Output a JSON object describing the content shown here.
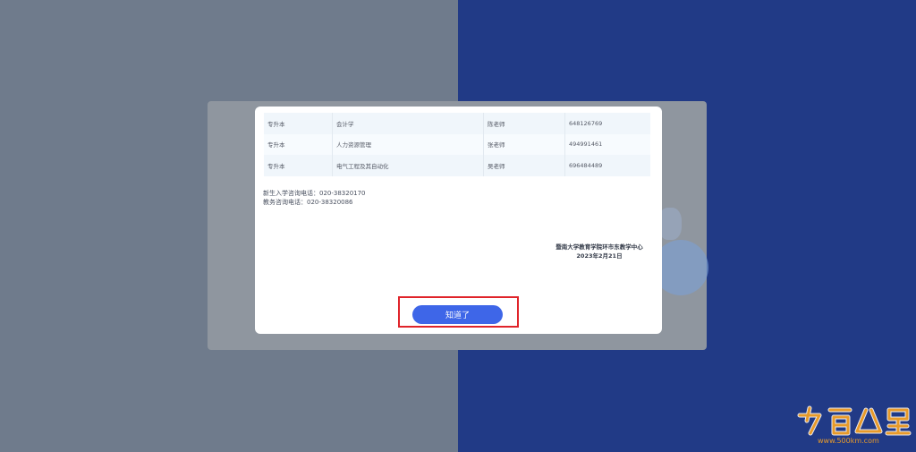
{
  "table": {
    "rows": [
      {
        "level": "专升本",
        "major": "会计学",
        "teacher": "陈老师",
        "qq": "648126769"
      },
      {
        "level": "专升本",
        "major": "人力资源管理",
        "teacher": "张老师",
        "qq": "494991461"
      },
      {
        "level": "专升本",
        "major": "电气工程及其自动化",
        "teacher": "吴老师",
        "qq": "696484489"
      }
    ]
  },
  "contact": {
    "admission": "新生入学咨询电话：020-38320170",
    "academic": "教务咨询电话：020-38320086"
  },
  "signature": {
    "org": "暨南大学教育学院环市东教学中心",
    "date": "2023年2月21日"
  },
  "buttons": {
    "ok_label": "知道了"
  },
  "watermark": {
    "url": "www.500km.com"
  },
  "colors": {
    "accent": "#3e66e8",
    "highlight": "#e0242a",
    "right_bg": "#213a86",
    "left_bg": "#6f7b8c"
  }
}
